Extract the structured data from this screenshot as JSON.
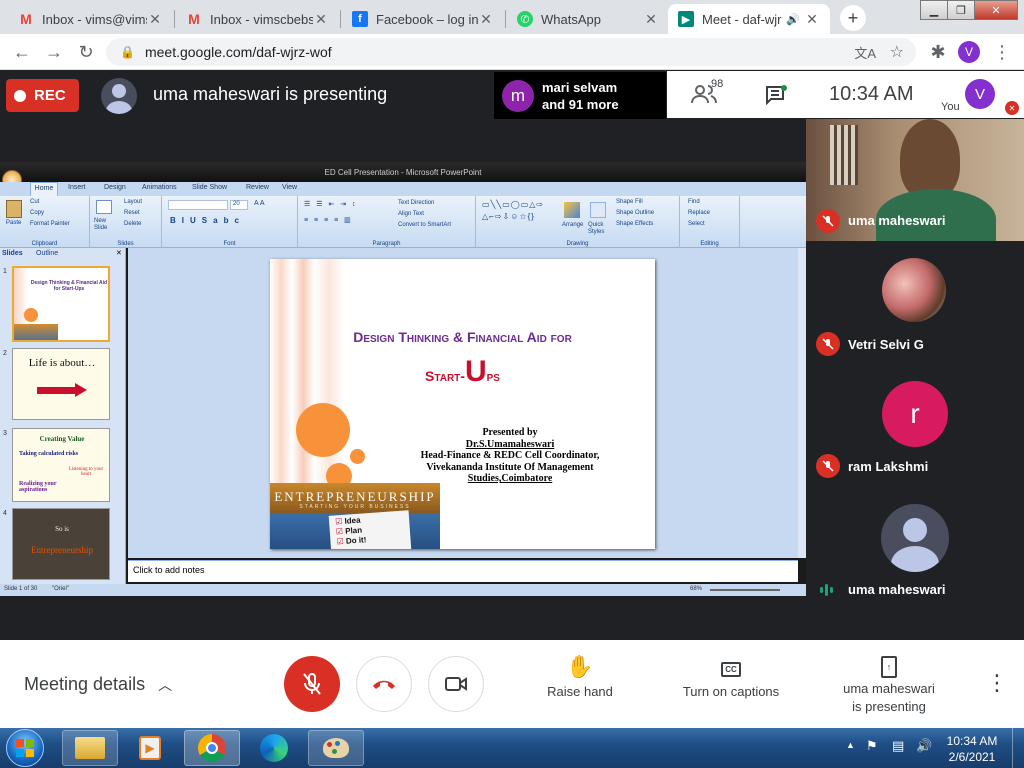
{
  "browser": {
    "tabs": [
      {
        "title": "Inbox - vims@vims",
        "icon": "gmail-icon"
      },
      {
        "title": "Inbox - vimscbebsc",
        "icon": "gmail-icon"
      },
      {
        "title": "Facebook – log in o",
        "icon": "facebook-icon"
      },
      {
        "title": "WhatsApp",
        "icon": "whatsapp-icon"
      },
      {
        "title": "Meet - daf-wjr",
        "icon": "meet-icon"
      }
    ],
    "new_tab": "+",
    "url": "meet.google.com/daf-wjrz-wof",
    "profile_initial": "V"
  },
  "meet": {
    "rec_label": "REC",
    "presenting_text": "uma maheswari is presenting",
    "others": {
      "initial": "m",
      "line1": "mari selvam",
      "line2": "and 91 more"
    },
    "participant_count": "98",
    "time": "10:34 AM",
    "self": {
      "initial": "V",
      "label": "You"
    },
    "participants": [
      {
        "name": "uma maheswari",
        "type": "video"
      },
      {
        "name": "Vetri Selvi G",
        "type": "photo"
      },
      {
        "name": "ram Lakshmi",
        "type": "initial",
        "initial": "r",
        "color": "#d81b60"
      },
      {
        "name": "uma maheswari",
        "type": "avatar"
      }
    ],
    "controls": {
      "meeting_details": "Meeting details",
      "raise_hand": "Raise hand",
      "captions": "Turn on captions",
      "presenting_line1": "uma maheswari",
      "presenting_line2": "is presenting"
    }
  },
  "ppt": {
    "window_title": "ED Cell Presentation - Microsoft PowerPoint",
    "ribbon_tabs": [
      "Home",
      "Insert",
      "Design",
      "Animations",
      "Slide Show",
      "Review",
      "View"
    ],
    "ribbon_groups": {
      "clipboard": {
        "label": "Clipboard",
        "paste": "Paste",
        "cut": "Cut",
        "copy": "Copy",
        "format_painter": "Format Painter"
      },
      "slides": {
        "label": "Slides",
        "new_slide": "New Slide",
        "layout": "Layout",
        "reset": "Reset",
        "delete": "Delete"
      },
      "font": {
        "label": "Font",
        "size": "20"
      },
      "paragraph": {
        "label": "Paragraph",
        "text_direction": "Text Direction",
        "align_text": "Align Text",
        "smartart": "Convert to SmartArt"
      },
      "drawing": {
        "label": "Drawing",
        "arrange": "Arrange",
        "quick_styles": "Quick Styles",
        "shape_fill": "Shape Fill",
        "shape_outline": "Shape Outline",
        "shape_effects": "Shape Effects"
      },
      "editing": {
        "label": "Editing",
        "find": "Find",
        "replace": "Replace",
        "select": "Select"
      }
    },
    "panel_tabs": [
      "Slides",
      "Outline"
    ],
    "thumbnails": [
      {
        "num": "1",
        "text": "Design Thinking & Financial Aid for Start-Ups"
      },
      {
        "num": "2",
        "text": "Life is about…"
      },
      {
        "num": "3",
        "line1": "Creating Value",
        "line2": "Taking calculated risks",
        "line3": "Listening to your heart",
        "line4": "Realizing your aspirations"
      },
      {
        "num": "4",
        "line1": "So is",
        "line2": "Entrepreneurship"
      }
    ],
    "slide": {
      "title_line1": "Design Thinking & Financial Aid for",
      "title_line2_a": "Start-",
      "title_line2_b": "U",
      "title_line2_c": "ps",
      "presented_by": "Presented by",
      "author": "Dr.S.Umamaheswari",
      "role": "Head-Finance & REDC Cell Coordinator,",
      "institute": "Vivekananda Institute Of Management",
      "location": "Studies,Coimbatore",
      "image_title": "ENTREPRENEURSHIP",
      "image_sub": "STARTING YOUR BUSINESS",
      "checklist": [
        "Idea",
        "Plan",
        "Do it!"
      ]
    },
    "notes_placeholder": "Click to add notes",
    "status": {
      "slide": "Slide 1 of 30",
      "theme": "\"Oriel\"",
      "zoom": "68%"
    }
  },
  "taskbar": {
    "time": "10:34 AM",
    "date": "2/6/2021"
  }
}
